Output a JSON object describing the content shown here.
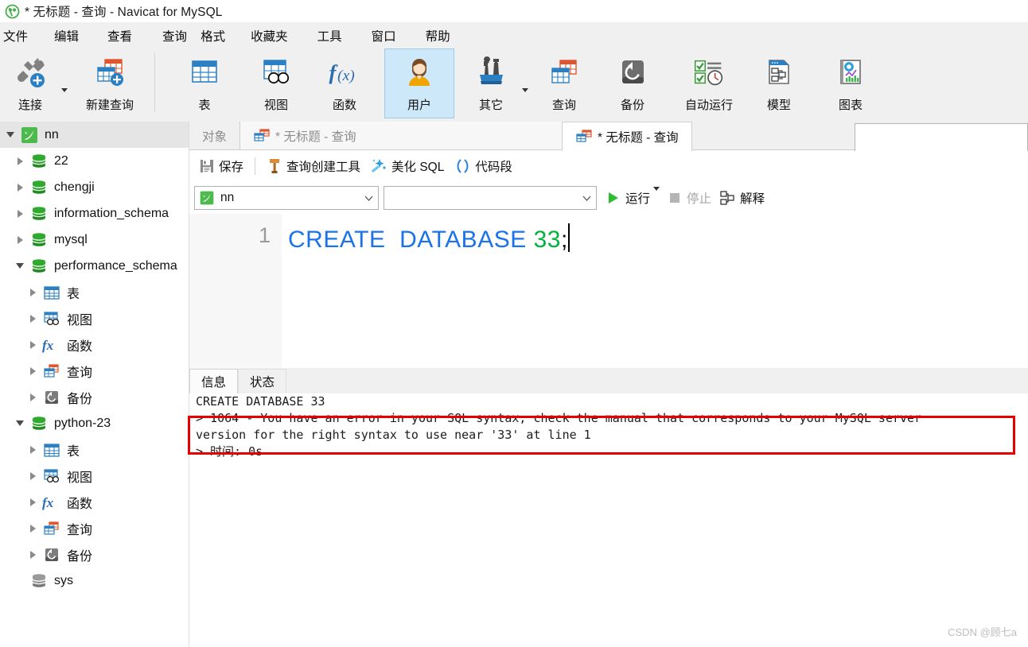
{
  "window": {
    "title": "* 无标题 - 查询 - Navicat for MySQL",
    "logo_icon": "navicat-logo-icon"
  },
  "menubar": {
    "items": [
      {
        "label": "文件"
      },
      {
        "label": "编辑"
      },
      {
        "label": "查看"
      },
      {
        "label": "查询"
      },
      {
        "label": "格式"
      },
      {
        "label": "收藏夹"
      },
      {
        "label": "工具"
      },
      {
        "label": "窗口"
      },
      {
        "label": "帮助"
      }
    ]
  },
  "toolbar": {
    "buttons": [
      {
        "label": "连接",
        "icon": "connection-icon",
        "has_caret": true,
        "active": false
      },
      {
        "label": "新建查询",
        "icon": "new-query-icon",
        "has_caret": false,
        "active": false
      },
      {
        "label": "表",
        "icon": "table-icon",
        "has_caret": false,
        "active": false
      },
      {
        "label": "视图",
        "icon": "view-icon",
        "has_caret": false,
        "active": false
      },
      {
        "label": "函数",
        "icon": "function-icon",
        "has_caret": false,
        "active": false
      },
      {
        "label": "用户",
        "icon": "user-icon",
        "has_caret": false,
        "active": true
      },
      {
        "label": "其它",
        "icon": "others-icon",
        "has_caret": true,
        "active": false
      },
      {
        "label": "查询",
        "icon": "query-icon",
        "has_caret": false,
        "active": false
      },
      {
        "label": "备份",
        "icon": "backup-icon",
        "has_caret": false,
        "active": false
      },
      {
        "label": "自动运行",
        "icon": "automation-icon",
        "has_caret": false,
        "active": false
      },
      {
        "label": "模型",
        "icon": "model-icon",
        "has_caret": false,
        "active": false
      },
      {
        "label": "图表",
        "icon": "chart-icon",
        "has_caret": false,
        "active": false
      }
    ]
  },
  "sidebar": {
    "nodes": [
      {
        "label": "nn",
        "icon": "mysql-connection-icon",
        "indent": 0,
        "state": "expanded",
        "selected": true
      },
      {
        "label": "22",
        "icon": "database-icon",
        "indent": 1,
        "state": "collapsed",
        "selected": false
      },
      {
        "label": "chengji",
        "icon": "database-icon",
        "indent": 1,
        "state": "collapsed",
        "selected": false
      },
      {
        "label": "information_schema",
        "icon": "database-icon",
        "indent": 1,
        "state": "collapsed",
        "selected": false
      },
      {
        "label": "mysql",
        "icon": "database-icon",
        "indent": 1,
        "state": "collapsed",
        "selected": false
      },
      {
        "label": "performance_schema",
        "icon": "database-icon",
        "indent": 1,
        "state": "expanded",
        "selected": false
      },
      {
        "label": "表",
        "icon": "table-icon",
        "indent": 2,
        "state": "collapsed",
        "selected": false
      },
      {
        "label": "视图",
        "icon": "view-icon",
        "indent": 2,
        "state": "collapsed",
        "selected": false
      },
      {
        "label": "函数",
        "icon": "function-icon",
        "indent": 2,
        "state": "collapsed",
        "selected": false
      },
      {
        "label": "查询",
        "icon": "query-icon",
        "indent": 2,
        "state": "collapsed",
        "selected": false
      },
      {
        "label": "备份",
        "icon": "backup-icon",
        "indent": 2,
        "state": "collapsed",
        "selected": false
      },
      {
        "label": "python-23",
        "icon": "database-icon",
        "indent": 1,
        "state": "expanded",
        "selected": false
      },
      {
        "label": "表",
        "icon": "table-icon",
        "indent": 2,
        "state": "collapsed",
        "selected": false
      },
      {
        "label": "视图",
        "icon": "view-icon",
        "indent": 2,
        "state": "collapsed",
        "selected": false
      },
      {
        "label": "函数",
        "icon": "function-icon",
        "indent": 2,
        "state": "collapsed",
        "selected": false
      },
      {
        "label": "查询",
        "icon": "query-icon",
        "indent": 2,
        "state": "collapsed",
        "selected": false
      },
      {
        "label": "备份",
        "icon": "backup-icon",
        "indent": 2,
        "state": "collapsed",
        "selected": false
      },
      {
        "label": "sys",
        "icon": "database-closed-icon",
        "indent": 1,
        "state": "leaf",
        "selected": false
      }
    ]
  },
  "tabs": {
    "objects_label": "对象",
    "background_query_label": "* 无标题 - 查询",
    "active_query_label": "* 无标题 - 查询"
  },
  "query_toolbar": {
    "save_label": "保存",
    "builder_label": "查询创建工具",
    "beautify_label": "美化 SQL",
    "snippet_label": "代码段"
  },
  "connection_bar": {
    "database_value": "nn",
    "object_value": "",
    "run_label": "运行",
    "stop_label": "停止",
    "explain_label": "解释"
  },
  "editor": {
    "line_number": "1",
    "keyword": "CREATE  DATABASE",
    "number": "33",
    "terminator": ";"
  },
  "result": {
    "tabs": [
      {
        "label": "信息",
        "active": true
      },
      {
        "label": "状态",
        "active": false
      }
    ],
    "lines": [
      "CREATE DATABASE 33",
      "> 1064 - You have an error in your SQL syntax; check the manual that corresponds to your MySQL server",
      "version for the right syntax to use near '33' at line 1",
      "> 时间: 0s"
    ]
  },
  "annotation": {
    "color": "#e60000"
  },
  "watermark": {
    "text": "CSDN @顾七a"
  }
}
